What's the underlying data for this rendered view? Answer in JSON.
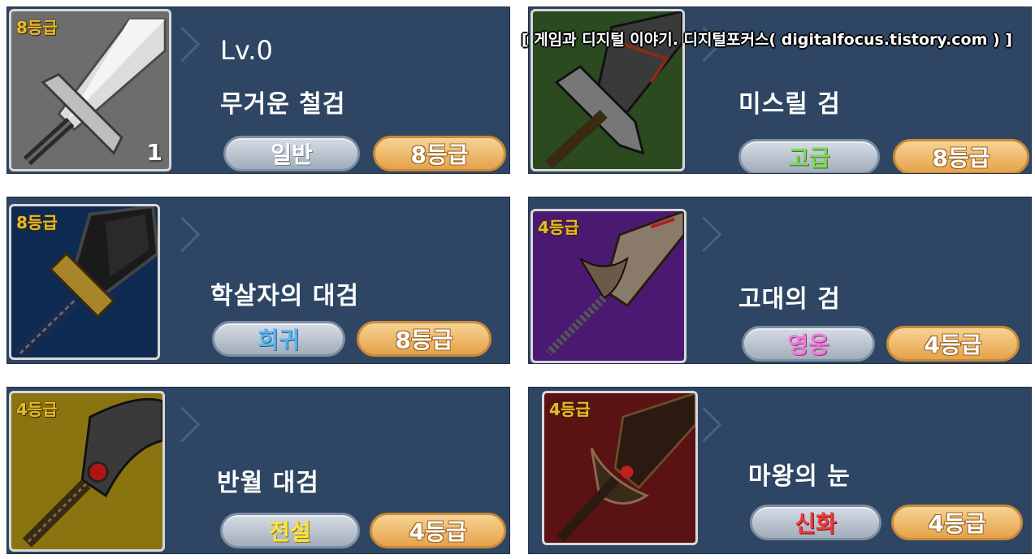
{
  "watermark": "[ 게임과 디지털 이야기. 디지털포커스( digitalfocus.tistory.com ) ]",
  "colors": {
    "panel": "#2e4663",
    "grade_pill": "#f0b864",
    "rarity_pill": "#b8c2ce",
    "common": "#ffffff",
    "uncommon": "#7ed957",
    "rare": "#58b6f0",
    "hero": "#f07ad8",
    "legend": "#ffe23a",
    "myth": "#f03a3a"
  },
  "items": [
    {
      "level": "Lv.0",
      "name": "무거운 철검",
      "rarity": "일반",
      "rarity_color": "#ffffff",
      "grade": "8등급",
      "corner_grade": "8등급",
      "count": "1",
      "icon_bg": "#6d6d6d",
      "icon": "iron-sword-icon"
    },
    {
      "level": "",
      "name": "미스릴 검",
      "rarity": "고급",
      "rarity_color": "#7ed957",
      "grade": "8등급",
      "corner_grade": "",
      "count": "",
      "icon_bg": "#2b4a1f",
      "icon": "mithril-sword-icon"
    },
    {
      "level": "",
      "name": "학살자의 대검",
      "rarity": "희귀",
      "rarity_color": "#58b6f0",
      "grade": "8등급",
      "corner_grade": "8등급",
      "count": "",
      "icon_bg": "#0f2a52",
      "icon": "slayer-greatsword-icon"
    },
    {
      "level": "",
      "name": "고대의 검",
      "rarity": "영웅",
      "rarity_color": "#f07ad8",
      "grade": "4등급",
      "corner_grade": "4등급",
      "count": "",
      "icon_bg": "#4a1a73",
      "icon": "ancient-sword-icon"
    },
    {
      "level": "",
      "name": "반월 대검",
      "rarity": "전설",
      "rarity_color": "#ffe23a",
      "grade": "4등급",
      "corner_grade": "4등급",
      "count": "",
      "icon_bg": "#8a7410",
      "icon": "half-moon-greatsword-icon"
    },
    {
      "level": "",
      "name": "마왕의 눈",
      "rarity": "신화",
      "rarity_color": "#f03a3a",
      "grade": "4등급",
      "corner_grade": "4등급",
      "count": "",
      "icon_bg": "#5a1212",
      "icon": "demon-king-eye-icon"
    }
  ]
}
